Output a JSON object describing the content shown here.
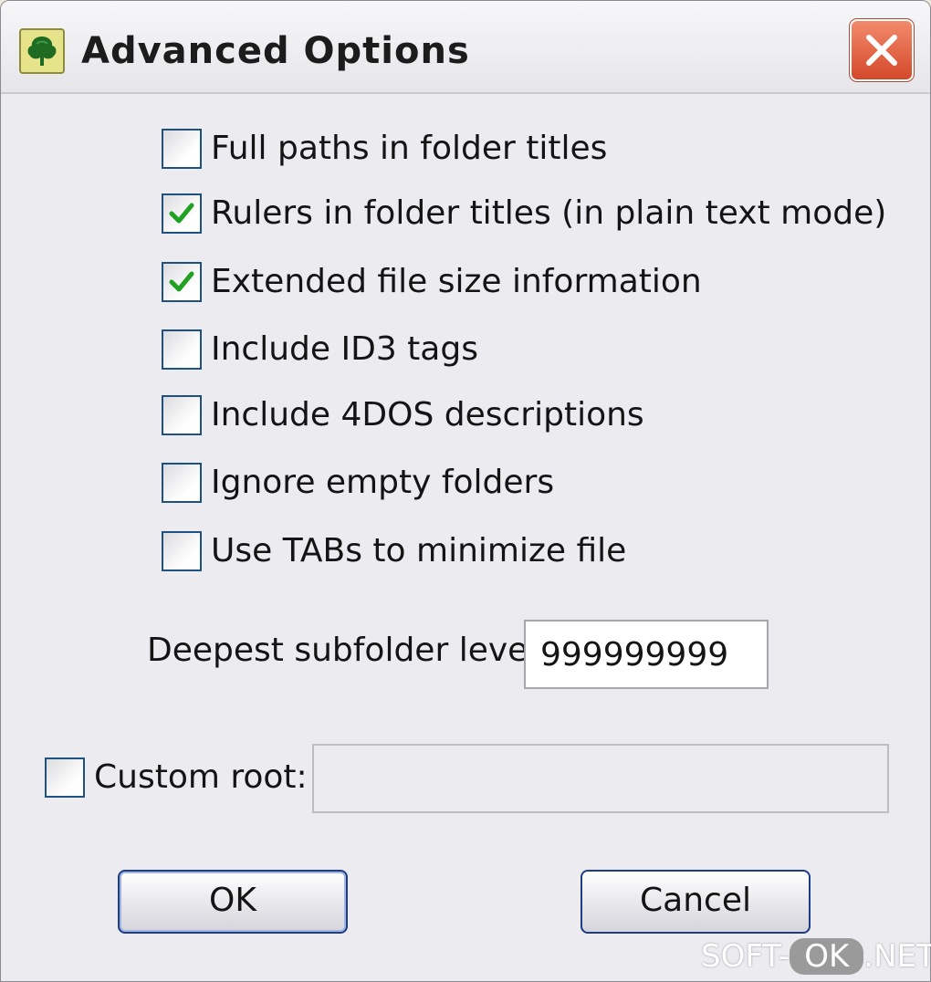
{
  "window": {
    "title": "Advanced Options"
  },
  "options": [
    {
      "label": "Full paths in folder titles",
      "checked": false
    },
    {
      "label": "Rulers in folder titles (in plain text mode)",
      "checked": true
    },
    {
      "label": "Extended file size information",
      "checked": true
    },
    {
      "label": "Include ID3 tags",
      "checked": false
    },
    {
      "label": "Include 4DOS descriptions",
      "checked": false
    },
    {
      "label": "Ignore empty folders",
      "checked": false
    },
    {
      "label": "Use TABs to minimize file",
      "checked": false
    }
  ],
  "depth": {
    "label": "Deepest subfolder level:",
    "value": "999999999"
  },
  "custom_root": {
    "label": "Custom root:",
    "checked": false,
    "value": ""
  },
  "buttons": {
    "ok": "OK",
    "cancel": "Cancel"
  },
  "watermark": {
    "prefix": "SOFT-",
    "pill": "OK",
    "suffix": ".NET"
  },
  "colors": {
    "check": "#21a121",
    "checkbox_border": "#1c5180",
    "button_border": "#1d3e86",
    "close_button": "#d4482a"
  },
  "icons": {
    "app": "tree-icon",
    "close": "close-icon",
    "check": "checkmark-icon"
  }
}
